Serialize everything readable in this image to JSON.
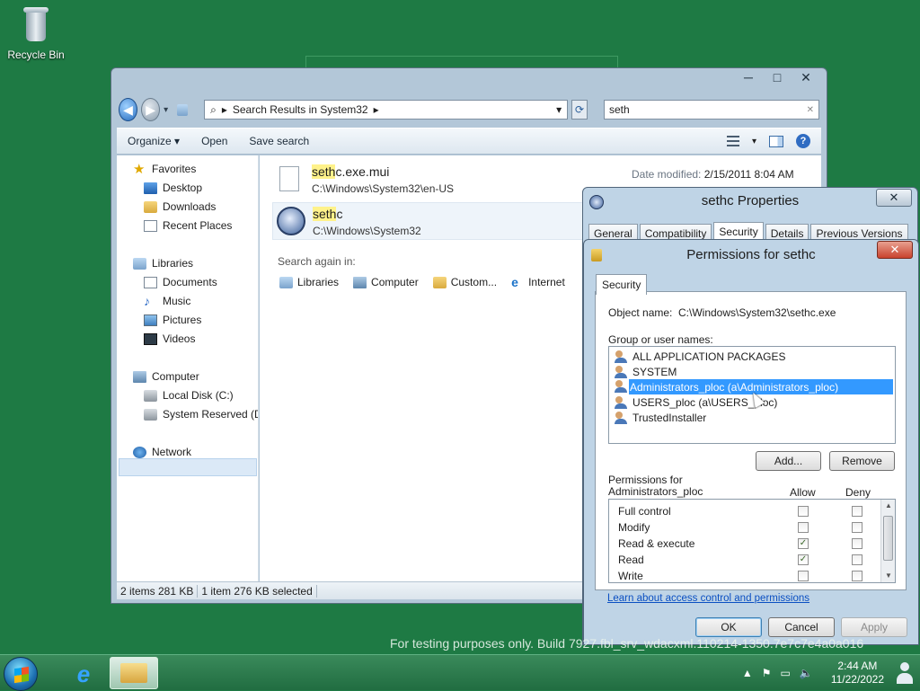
{
  "desktop": {
    "recycle_bin": "Recycle Bin",
    "watermark": "For testing purposes only. Build 7927.fbl_srv_wdacxml.110214-1350.7e7c7e4a0a016"
  },
  "explorer": {
    "title_controls": {
      "minimize": "─",
      "maximize": "□",
      "close": "✕"
    },
    "address": {
      "separator": "▸",
      "location": "Search Results in System32",
      "end_arrow": "▸",
      "dropdown": "▾"
    },
    "search_value": "seth",
    "search_clear": "✕",
    "toolbar": {
      "organize": "Organize ▾",
      "open": "Open",
      "save_search": "Save search",
      "view_dropdown": "▾",
      "help": "?"
    },
    "nav": {
      "favorites": "Favorites",
      "desktop": "Desktop",
      "downloads": "Downloads",
      "recent": "Recent Places",
      "libraries": "Libraries",
      "documents": "Documents",
      "music": "Music",
      "pictures": "Pictures",
      "videos": "Videos",
      "computer": "Computer",
      "local_disk": "Local Disk (C:)",
      "system_reserved": "System Reserved (D:",
      "network": "Network"
    },
    "results": [
      {
        "name_hl": "seth",
        "name_rest": "c.exe.mui",
        "path": "C:\\Windows\\System32\\en-US",
        "meta_label": "Date modified:",
        "meta_value": "2/15/2011 8:04 AM"
      },
      {
        "name_hl": "seth",
        "name_rest": "c",
        "path": "C:\\Windows\\System32"
      }
    ],
    "search_again": "Search again in:",
    "search_again_items": {
      "libraries": "Libraries",
      "computer": "Computer",
      "custom": "Custom...",
      "internet": "Internet"
    },
    "status": {
      "items": "2 items 281 KB",
      "selected": "1 item 276 KB selected"
    }
  },
  "props": {
    "title": "sethc Properties",
    "close": "✕",
    "tabs": [
      "General",
      "Compatibility",
      "Security",
      "Details",
      "Previous Versions"
    ]
  },
  "perm": {
    "title": "Permissions for sethc",
    "close": "✕",
    "tab": "Security",
    "object_label": "Object name:",
    "object_value": "C:\\Windows\\System32\\sethc.exe",
    "group_label": "Group or user names:",
    "groups": [
      "ALL APPLICATION PACKAGES",
      "SYSTEM",
      "Administrators_ploc (a\\Administrators_ploc)",
      "USERS_ploc (a\\USERS_ploc)",
      "TrustedInstaller"
    ],
    "add_button": "Add...",
    "remove_button": "Remove",
    "perms_for_line1": "Permissions for",
    "perms_for_line2": "Administrators_ploc",
    "allow": "Allow",
    "deny": "Deny",
    "permissions": [
      {
        "name": "Full control",
        "allow": "",
        "deny": ""
      },
      {
        "name": "Modify",
        "allow": "",
        "deny": ""
      },
      {
        "name": "Read & execute",
        "allow": "✓",
        "deny": ""
      },
      {
        "name": "Read",
        "allow": "✓",
        "deny": ""
      },
      {
        "name": "Write",
        "allow": "",
        "deny": ""
      }
    ],
    "learn_link": "Learn about access control and permissions",
    "ok": "OK",
    "cancel": "Cancel",
    "apply": "Apply"
  },
  "taskbar": {
    "tray": {
      "arrow": "▲",
      "flag": "⚑",
      "screen": "▭",
      "volume": "🔈"
    },
    "time": "2:44 AM",
    "date": "11/22/2022"
  }
}
